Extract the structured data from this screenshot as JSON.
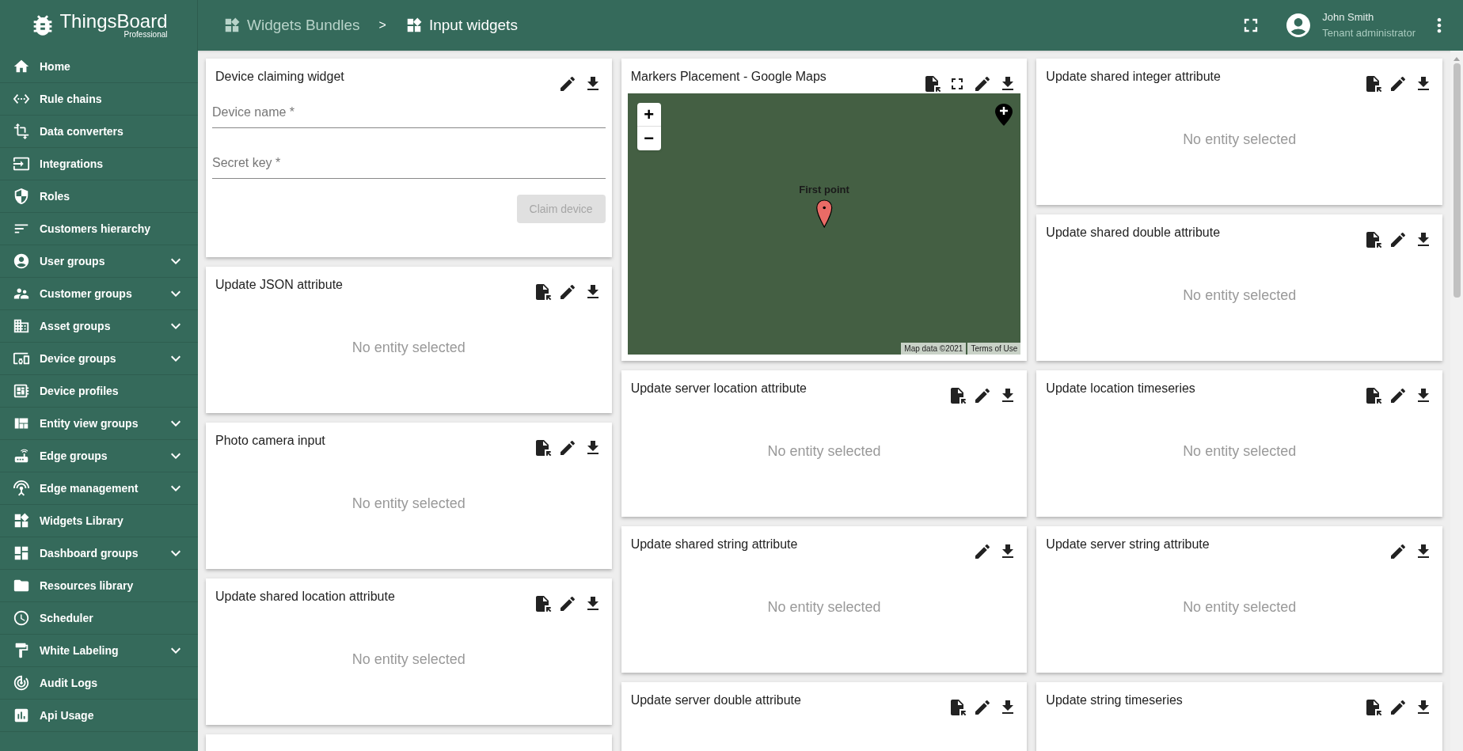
{
  "logo": {
    "name": "ThingsBoard",
    "edition": "Professional"
  },
  "breadcrumb": [
    {
      "label": "Widgets Bundles",
      "current": false
    },
    {
      "label": "Input widgets",
      "current": true
    }
  ],
  "breadcrumb_separator": ">",
  "user": {
    "name": "John Smith",
    "role": "Tenant administrator"
  },
  "sidebar": {
    "items": [
      {
        "label": "Home",
        "expandable": false
      },
      {
        "label": "Rule chains",
        "expandable": false
      },
      {
        "label": "Data converters",
        "expandable": false
      },
      {
        "label": "Integrations",
        "expandable": false
      },
      {
        "label": "Roles",
        "expandable": false
      },
      {
        "label": "Customers hierarchy",
        "expandable": false
      },
      {
        "label": "User groups",
        "expandable": true
      },
      {
        "label": "Customer groups",
        "expandable": true
      },
      {
        "label": "Asset groups",
        "expandable": true
      },
      {
        "label": "Device groups",
        "expandable": true
      },
      {
        "label": "Device profiles",
        "expandable": false
      },
      {
        "label": "Entity view groups",
        "expandable": true
      },
      {
        "label": "Edge groups",
        "expandable": true
      },
      {
        "label": "Edge management",
        "expandable": true
      },
      {
        "label": "Widgets Library",
        "expandable": false
      },
      {
        "label": "Dashboard groups",
        "expandable": true
      },
      {
        "label": "Resources library",
        "expandable": false
      },
      {
        "label": "Scheduler",
        "expandable": false
      },
      {
        "label": "White Labeling",
        "expandable": true
      },
      {
        "label": "Audit Logs",
        "expandable": false
      },
      {
        "label": "Api Usage",
        "expandable": false
      }
    ]
  },
  "columns": [
    [
      {
        "kind": "claim",
        "title": "Device claiming widget",
        "actions": [
          {
            "kind": "edit"
          },
          {
            "kind": "download"
          }
        ],
        "fields": [
          {
            "placeholder": "Device name *"
          },
          {
            "placeholder": "Secret key *"
          }
        ],
        "button": {
          "label": "Claim device",
          "disabled": true
        }
      },
      {
        "kind": "empty",
        "title": "Update JSON attribute",
        "actions": [
          {
            "kind": "export"
          },
          {
            "kind": "edit"
          },
          {
            "kind": "download"
          }
        ],
        "message": "No entity selected"
      },
      {
        "kind": "empty",
        "title": "Photo camera input",
        "actions": [
          {
            "kind": "export"
          },
          {
            "kind": "edit"
          },
          {
            "kind": "download"
          }
        ],
        "message": "No entity selected"
      },
      {
        "kind": "empty",
        "title": "Update shared location attribute",
        "actions": [
          {
            "kind": "export"
          },
          {
            "kind": "edit"
          },
          {
            "kind": "download"
          }
        ],
        "message": "No entity selected"
      },
      {
        "kind": "empty"
      }
    ],
    [
      {
        "kind": "map",
        "title": "Markers Placement - Google Maps",
        "actions": [
          {
            "kind": "export"
          },
          {
            "kind": "fullscreen"
          },
          {
            "kind": "edit"
          },
          {
            "kind": "download"
          }
        ],
        "zoom_in": "+",
        "zoom_out": "−",
        "marker_label": "First point",
        "attribution": "Map data ©2021",
        "terms": "Terms of Use"
      },
      {
        "kind": "empty",
        "title": "Update server location attribute",
        "actions": [
          {
            "kind": "export"
          },
          {
            "kind": "edit"
          },
          {
            "kind": "download"
          }
        ],
        "message": "No entity selected"
      },
      {
        "kind": "empty",
        "title": "Update shared string attribute",
        "actions": [
          {
            "kind": "edit"
          },
          {
            "kind": "download"
          }
        ],
        "message": "No entity selected"
      },
      {
        "kind": "empty",
        "title": "Update server double attribute",
        "actions": [
          {
            "kind": "export"
          },
          {
            "kind": "edit"
          },
          {
            "kind": "download"
          }
        ]
      }
    ],
    [
      {
        "kind": "empty",
        "title": "Update shared integer attribute",
        "actions": [
          {
            "kind": "export"
          },
          {
            "kind": "edit"
          },
          {
            "kind": "download"
          }
        ],
        "message": "No entity selected"
      },
      {
        "kind": "empty",
        "title": "Update shared double attribute",
        "actions": [
          {
            "kind": "export"
          },
          {
            "kind": "edit"
          },
          {
            "kind": "download"
          }
        ],
        "message": "No entity selected"
      },
      {
        "kind": "empty",
        "title": "Update location timeseries",
        "actions": [
          {
            "kind": "export"
          },
          {
            "kind": "edit"
          },
          {
            "kind": "download"
          }
        ],
        "message": "No entity selected"
      },
      {
        "kind": "empty",
        "title": "Update server string attribute",
        "actions": [
          {
            "kind": "edit"
          },
          {
            "kind": "download"
          }
        ],
        "message": "No entity selected"
      },
      {
        "kind": "empty",
        "title": "Update string timeseries",
        "actions": [
          {
            "kind": "export"
          },
          {
            "kind": "edit"
          },
          {
            "kind": "download"
          }
        ]
      }
    ]
  ]
}
